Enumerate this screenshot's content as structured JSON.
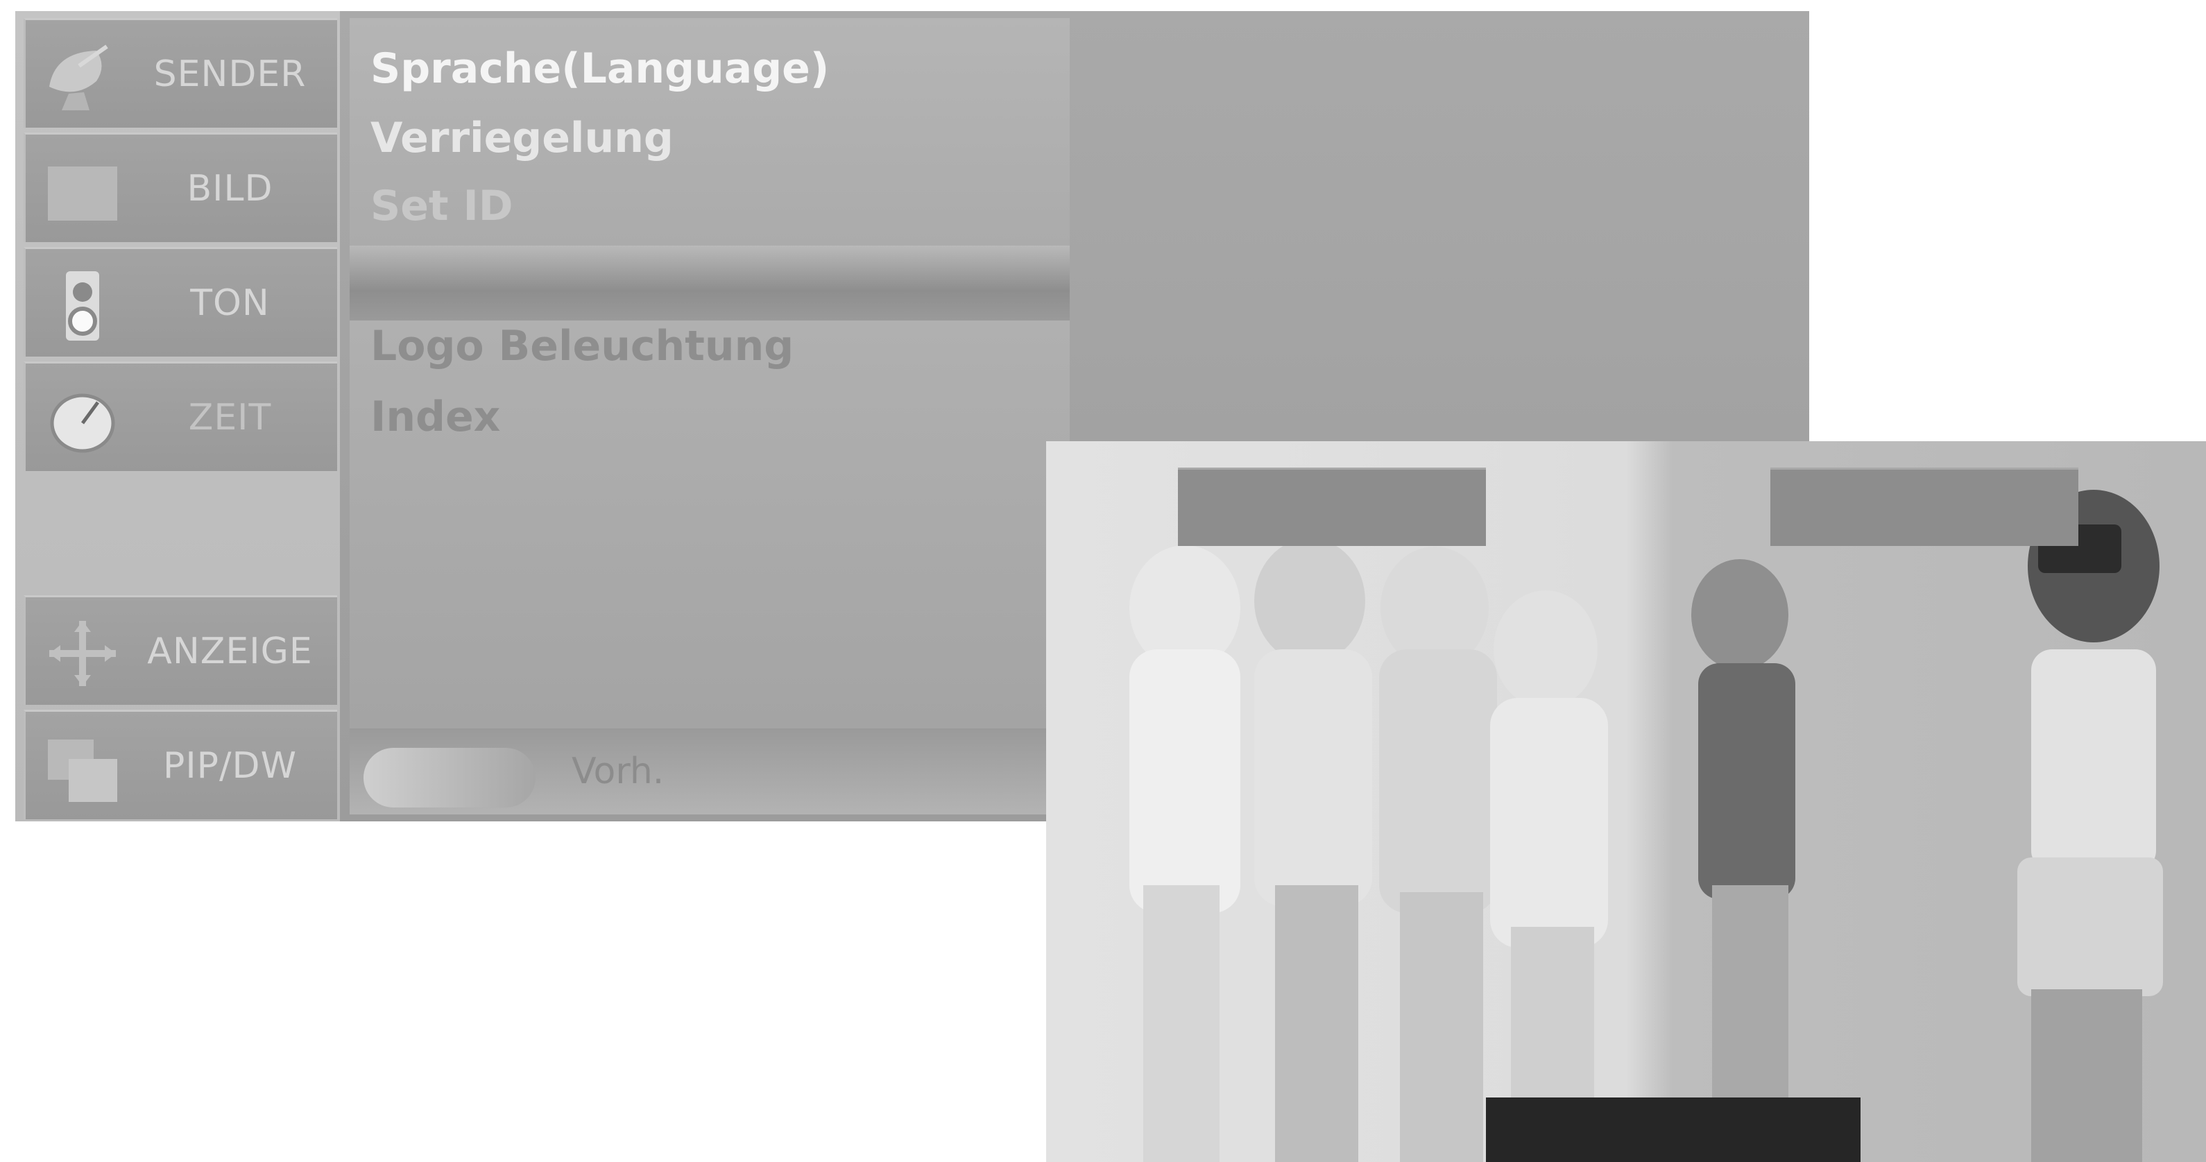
{
  "sidebar": {
    "items": [
      {
        "label": "SENDER",
        "icon": "satellite-dish-icon"
      },
      {
        "label": "BILD",
        "icon": "picture-icon"
      },
      {
        "label": "TON",
        "icon": "speaker-icon"
      },
      {
        "label": "ZEIT",
        "icon": "clock-icon"
      },
      {
        "label": "ANZEIGE",
        "icon": "arrows-icon"
      },
      {
        "label": "PIP/DW",
        "icon": "pip-icon"
      }
    ]
  },
  "menu": {
    "items": [
      "Sprache(Language)",
      "Verriegelung",
      "Set ID",
      "Logo Beleuchtung",
      "Index"
    ]
  },
  "footer": {
    "prev_label": "Vorh."
  }
}
